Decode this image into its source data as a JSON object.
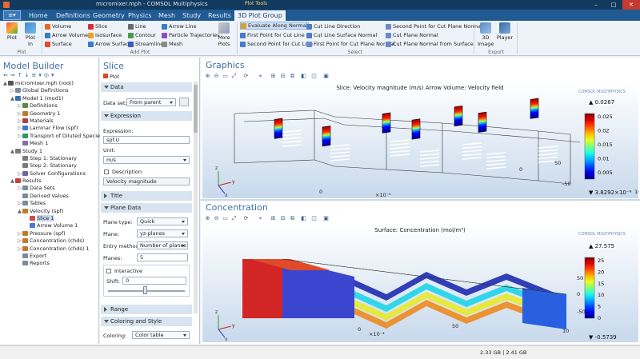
{
  "window": {
    "title": "micromixer.mph - COMSOL Multiphysics",
    "context_tab": "Plot Tools",
    "controls": [
      "–",
      "□",
      "✕"
    ]
  },
  "ribbon": {
    "file_label": "File",
    "tabs": [
      "Home",
      "Definitions",
      "Geometry",
      "Physics",
      "Mesh",
      "Study",
      "Results",
      "3D Plot Group"
    ],
    "active_tab": "3D Plot Group",
    "plot_group": {
      "plot": "Plot",
      "plot_in": "Plot In",
      "label": "Plot"
    },
    "add_plot": {
      "items_col1": [
        "Volume",
        "Arrow Volume",
        "Surface"
      ],
      "items_col2": [
        "Slice",
        "Isosurface",
        "Arrow Surface"
      ],
      "items_col3": [
        "Line",
        "Contour",
        "Streamline"
      ],
      "items_col4": [
        "Arrow Line",
        "Particle Trajectories",
        "Mesh"
      ],
      "more": "More Plots",
      "label": "Add Plot"
    },
    "select": {
      "col1": [
        "Evaluate Along Normal",
        "First Point for Cut Line",
        "Second Point for Cut Line"
      ],
      "col2": [
        "Cut Line Direction",
        "Cut Line Surface Normal",
        "First Point for Cut Plane Normal"
      ],
      "col3": [
        "Second Point for Cut Plane Normal",
        "Cut Plane Normal",
        "Cut Plane Normal from Surface"
      ],
      "label": "Select"
    },
    "export": {
      "image": "3D Image",
      "player": "Player",
      "label": "Export"
    }
  },
  "model_builder": {
    "title": "Model Builder",
    "tree": [
      {
        "label": "micromixer.mph (root)",
        "level": 0,
        "tw": "▲",
        "color": "#555"
      },
      {
        "label": "Global Definitions",
        "level": 1,
        "tw": "▷",
        "color": "#7a8aa0"
      },
      {
        "label": "Model 1 (mod1)",
        "level": 1,
        "tw": "▲",
        "color": "#3b6fb0"
      },
      {
        "label": "Definitions",
        "level": 2,
        "tw": "▷",
        "color": "#5a8a4a"
      },
      {
        "label": "Geometry 1",
        "level": 2,
        "tw": "▷",
        "color": "#c07a2a"
      },
      {
        "label": "Materials",
        "level": 2,
        "tw": "▷",
        "color": "#b04040"
      },
      {
        "label": "Laminar Flow (spf)",
        "level": 2,
        "tw": "▷",
        "color": "#3b7ad0"
      },
      {
        "label": "Transport of Diluted Species (chds)",
        "level": 2,
        "tw": "▷",
        "color": "#2a9a6a"
      },
      {
        "label": "Mesh 1",
        "level": 2,
        "tw": "",
        "color": "#8a6ab0"
      },
      {
        "label": "Study 1",
        "level": 1,
        "tw": "▲",
        "color": "#7a7a7a"
      },
      {
        "label": "Step 1: Stationary",
        "level": 2,
        "tw": "",
        "color": "#7a7a7a"
      },
      {
        "label": "Step 2: Stationary",
        "level": 2,
        "tw": "",
        "color": "#7a7a7a"
      },
      {
        "label": "Solver Configurations",
        "level": 2,
        "tw": "▷",
        "color": "#6a6a9a"
      },
      {
        "label": "Results",
        "level": 1,
        "tw": "▲",
        "color": "#c04040"
      },
      {
        "label": "Data Sets",
        "level": 2,
        "tw": "▷",
        "color": "#7a8aa0"
      },
      {
        "label": "Derived Values",
        "level": 2,
        "tw": "",
        "color": "#7a8aa0"
      },
      {
        "label": "Tables",
        "level": 2,
        "tw": "▷",
        "color": "#7a8aa0"
      },
      {
        "label": "Velocity (spf)",
        "level": 2,
        "tw": "▲",
        "color": "#c07a2a"
      },
      {
        "label": "Slice 1",
        "level": 3,
        "tw": "",
        "color": "#d04a4a",
        "selected": true
      },
      {
        "label": "Arrow Volume 1",
        "level": 3,
        "tw": "",
        "color": "#4a7ad0"
      },
      {
        "label": "Pressure (spf)",
        "level": 2,
        "tw": "▷",
        "color": "#c07a2a"
      },
      {
        "label": "Concentration (chds)",
        "level": 2,
        "tw": "▷",
        "color": "#c07a2a"
      },
      {
        "label": "Concentration (chds) 1",
        "level": 2,
        "tw": "▷",
        "color": "#c07a2a"
      },
      {
        "label": "Export",
        "level": 2,
        "tw": "",
        "color": "#7a8aa0"
      },
      {
        "label": "Reports",
        "level": 2,
        "tw": "",
        "color": "#7a8aa0"
      }
    ]
  },
  "settings": {
    "title": "Slice",
    "plot_button": "Plot",
    "data_section": "Data",
    "data_set_label": "Data set:",
    "data_set_value": "From parent",
    "expression_section": "Expression",
    "expression_label": "Expression:",
    "expression_value": "spf.U",
    "unit_label": "Unit:",
    "unit_value": "m/s",
    "description_label": "Description:",
    "description_value": "Velocity magnitude",
    "title_section": "Title",
    "plane_data_section": "Plane Data",
    "plane_type_label": "Plane type:",
    "plane_type_value": "Quick",
    "plane_label": "Plane:",
    "plane_value": "yz-planes",
    "entry_method_label": "Entry method:",
    "entry_method_value": "Number of planes",
    "planes_label": "Planes:",
    "planes_value": "5",
    "interactive_label": "Interactive",
    "shift_label": "Shift:",
    "shift_value": "0",
    "range_section": "Range",
    "coloring_section": "Coloring and Style",
    "coloring_label": "Coloring:",
    "coloring_value": "Color table"
  },
  "graphics": {
    "title": "Graphics",
    "plot_title": "Slice: Velocity magnitude (m/s)  Arrow Volume: Velocity field",
    "watermark": "COMSOL MULTIPHYSICS",
    "max_label": "▲ 0.0267",
    "min_label": "▼ 3.8292×10⁻⁶",
    "colorbar_ticks": [
      "0.025",
      "0.02",
      "0.015",
      "0.01",
      "0.005"
    ],
    "axis_labels": [
      "0",
      "50",
      "-50",
      "0",
      "10",
      "×10⁻⁴"
    ],
    "triad": {
      "z": "z",
      "y": "y",
      "x": "x"
    }
  },
  "concentration": {
    "title": "Concentration",
    "plot_title": "Surface: Concentration (mol/m³)",
    "watermark": "COMSOL MULTIPHYSICS",
    "max_label": "▲ 27.575",
    "min_label": "▼ -0.5739",
    "colorbar_ticks": [
      "25",
      "20",
      "15",
      "10",
      "5",
      "0"
    ],
    "axis_labels": [
      "50",
      "0",
      "-50",
      "0",
      "50",
      "10",
      "×10⁻⁴"
    ],
    "triad": {
      "z": "z",
      "y": "y",
      "x": "x"
    }
  },
  "status": {
    "memory": "2.33 GB | 2.41 GB"
  },
  "colors": {
    "accent": "#1f5a93",
    "title": "#3f6fa1",
    "hot": "#d81e1e",
    "cold": "#1a1aa8"
  }
}
